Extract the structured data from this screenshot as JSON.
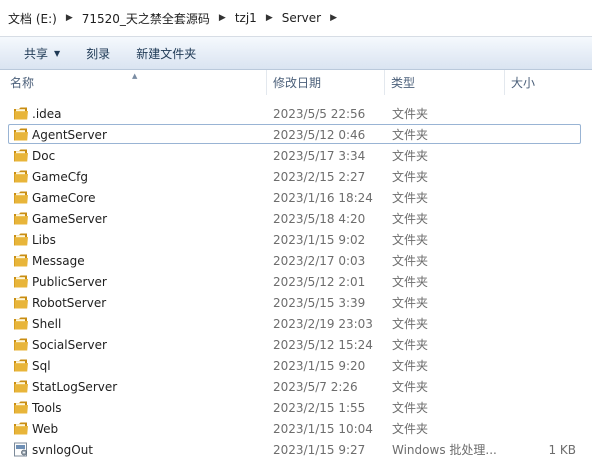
{
  "breadcrumb": [
    "文档 (E:)",
    "71520_天之禁全套源码",
    "tzj1",
    "Server"
  ],
  "toolbar": {
    "share_label": "共享",
    "burn_label": "刻录",
    "new_folder_label": "新建文件夹"
  },
  "columns": {
    "name": "名称",
    "date": "修改日期",
    "type": "类型",
    "size": "大小"
  },
  "files": [
    {
      "name": ".idea",
      "date": "2023/5/5 22:56",
      "type": "文件夹",
      "size": "",
      "icon": "folder-icon"
    },
    {
      "name": "AgentServer",
      "date": "2023/5/12 0:46",
      "type": "文件夹",
      "size": "",
      "icon": "folder-icon"
    },
    {
      "name": "Doc",
      "date": "2023/5/17 3:34",
      "type": "文件夹",
      "size": "",
      "icon": "folder-icon"
    },
    {
      "name": "GameCfg",
      "date": "2023/2/15 2:27",
      "type": "文件夹",
      "size": "",
      "icon": "folder-icon"
    },
    {
      "name": "GameCore",
      "date": "2023/1/16 18:24",
      "type": "文件夹",
      "size": "",
      "icon": "folder-icon"
    },
    {
      "name": "GameServer",
      "date": "2023/5/18 4:20",
      "type": "文件夹",
      "size": "",
      "icon": "folder-icon"
    },
    {
      "name": "Libs",
      "date": "2023/1/15 9:02",
      "type": "文件夹",
      "size": "",
      "icon": "folder-icon"
    },
    {
      "name": "Message",
      "date": "2023/2/17 0:03",
      "type": "文件夹",
      "size": "",
      "icon": "folder-icon"
    },
    {
      "name": "PublicServer",
      "date": "2023/5/12 2:01",
      "type": "文件夹",
      "size": "",
      "icon": "folder-icon"
    },
    {
      "name": "RobotServer",
      "date": "2023/5/15 3:39",
      "type": "文件夹",
      "size": "",
      "icon": "folder-icon"
    },
    {
      "name": "Shell",
      "date": "2023/2/19 23:03",
      "type": "文件夹",
      "size": "",
      "icon": "folder-icon"
    },
    {
      "name": "SocialServer",
      "date": "2023/5/12 15:24",
      "type": "文件夹",
      "size": "",
      "icon": "folder-icon"
    },
    {
      "name": "Sql",
      "date": "2023/1/15 9:20",
      "type": "文件夹",
      "size": "",
      "icon": "folder-icon"
    },
    {
      "name": "StatLogServer",
      "date": "2023/5/7 2:26",
      "type": "文件夹",
      "size": "",
      "icon": "folder-icon"
    },
    {
      "name": "Tools",
      "date": "2023/2/15 1:55",
      "type": "文件夹",
      "size": "",
      "icon": "folder-icon"
    },
    {
      "name": "Web",
      "date": "2023/1/15 10:04",
      "type": "文件夹",
      "size": "",
      "icon": "folder-icon"
    },
    {
      "name": "svnlogOut",
      "date": "2023/1/15 9:27",
      "type": "Windows 批处理...",
      "size": "1 KB",
      "icon": "batch-file-icon"
    }
  ],
  "focused_index": 1,
  "colors": {
    "folder": "#e8b53a",
    "folder_dark": "#c98d12",
    "focus_border": "#99b4d4",
    "toolbar_text": "#1e3955"
  }
}
